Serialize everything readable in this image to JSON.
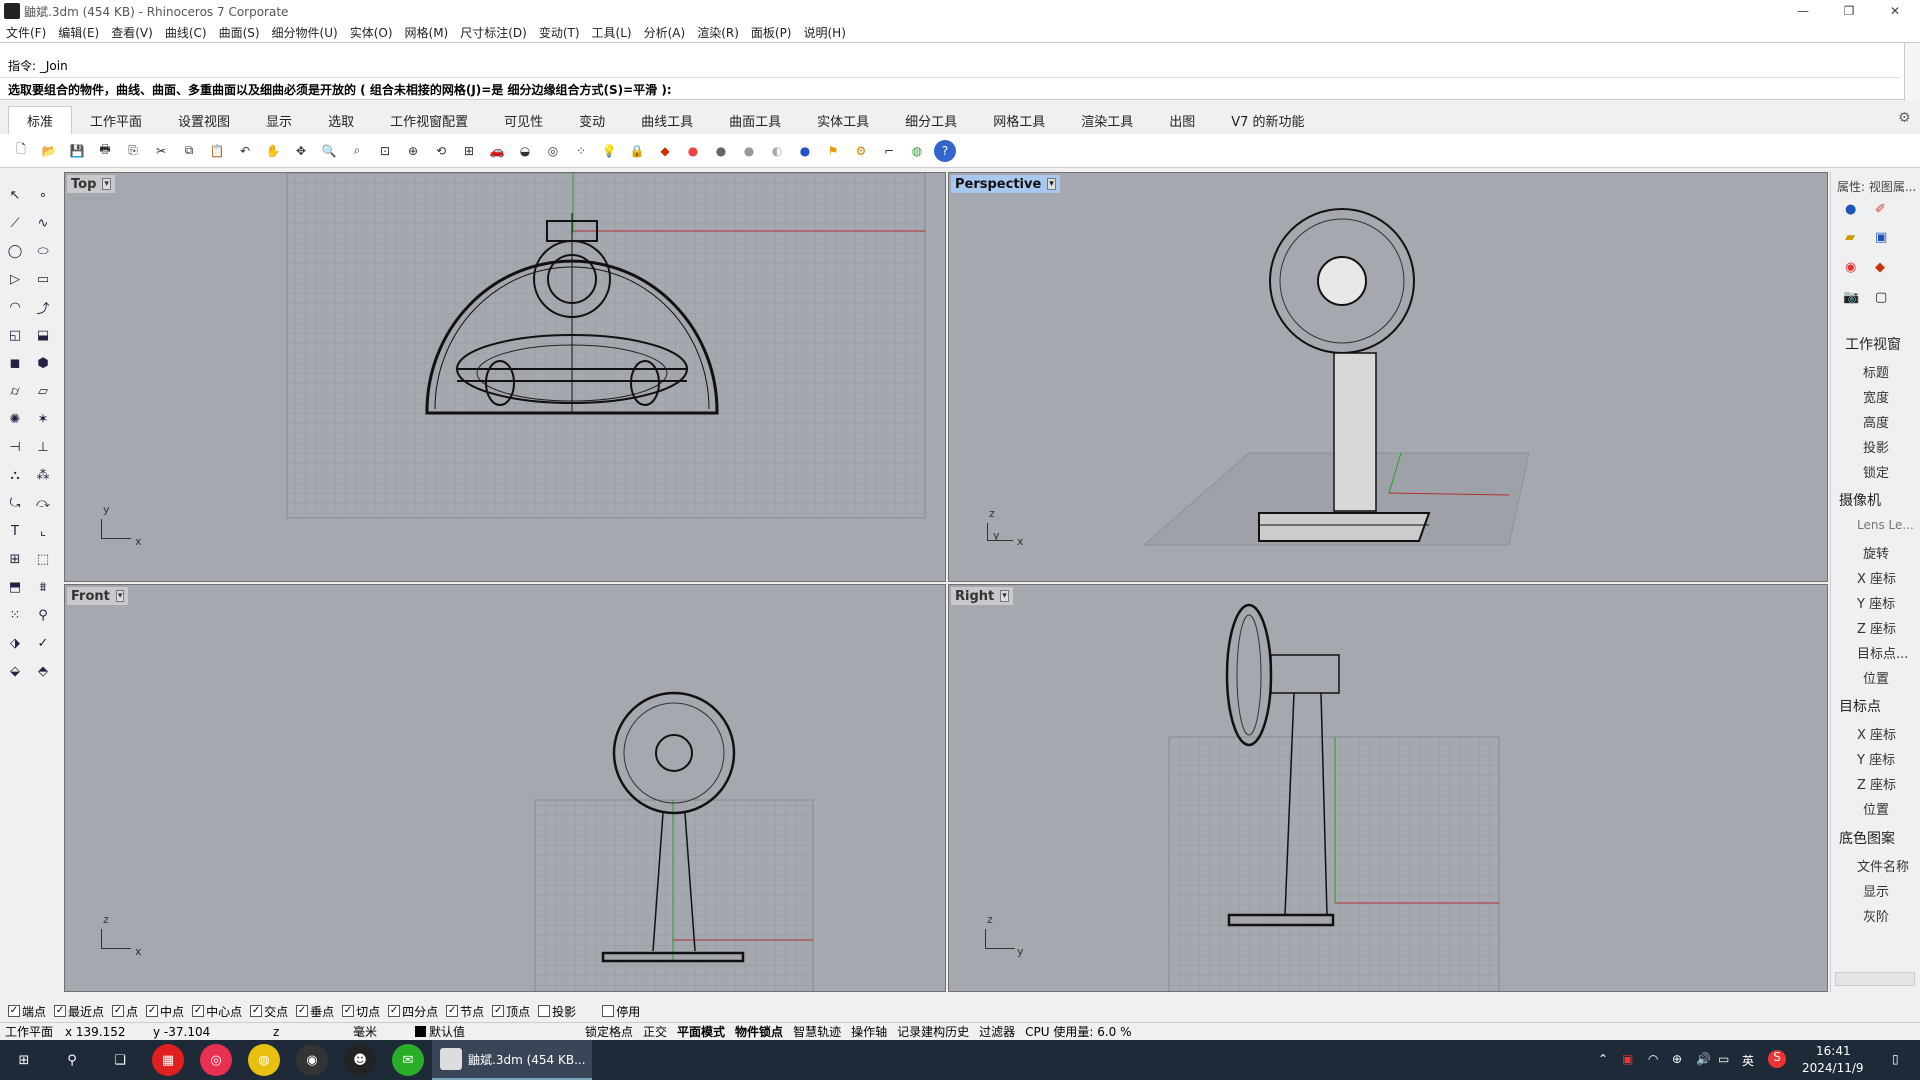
{
  "window": {
    "title": "鼬斌.3dm (454 KB) - Rhinoceros 7 Corporate"
  },
  "menu": [
    "文件(F)",
    "编辑(E)",
    "查看(V)",
    "曲线(C)",
    "曲面(S)",
    "细分物件(U)",
    "实体(O)",
    "网格(M)",
    "尺寸标注(D)",
    "变动(T)",
    "工具(L)",
    "分析(A)",
    "渲染(R)",
    "面板(P)",
    "说明(H)"
  ],
  "command": {
    "history_line": "指令: _Join",
    "prompt": "选取要组合的物件，曲线、曲面、多重曲面以及细曲必须是开放的 ( 组合未相接的网格(J)=是  细分边缘组合方式(S)=平滑 ):"
  },
  "tabs": [
    "标准",
    "工作平面",
    "设置视图",
    "显示",
    "选取",
    "工作视窗配置",
    "可见性",
    "变动",
    "曲线工具",
    "曲面工具",
    "实体工具",
    "细分工具",
    "网格工具",
    "渲染工具",
    "出图",
    "V7 的新功能"
  ],
  "viewports": {
    "top": {
      "label": "Top",
      "axes": [
        "y",
        "x"
      ]
    },
    "perspective": {
      "label": "Perspective",
      "axes": [
        "z",
        "y",
        "x"
      ]
    },
    "front": {
      "label": "Front",
      "axes": [
        "z",
        "x"
      ]
    },
    "right": {
      "label": "Right",
      "axes": [
        "z",
        "y"
      ]
    }
  },
  "right_panel": {
    "header": "属性: 视图属...",
    "section_viewport": "工作视窗",
    "viewport_items": [
      "标题",
      "宽度",
      "高度",
      "投影",
      "锁定"
    ],
    "section_camera": "摄像机",
    "camera_items": [
      "Lens Le...",
      "旋转",
      "X 座标",
      "Y 座标",
      "Z 座标",
      "目标点...",
      "位置"
    ],
    "section_target": "目标点",
    "target_items": [
      "X 座标",
      "Y 座标",
      "Z 座标",
      "位置"
    ],
    "section_wallpaper": "底色图案",
    "wallpaper_items": [
      "文件名称",
      "显示",
      "灰阶"
    ]
  },
  "osnaps": [
    {
      "label": "端点",
      "checked": true
    },
    {
      "label": "最近点",
      "checked": true
    },
    {
      "label": "点",
      "checked": true
    },
    {
      "label": "中点",
      "checked": true
    },
    {
      "label": "中心点",
      "checked": true
    },
    {
      "label": "交点",
      "checked": true
    },
    {
      "label": "垂点",
      "checked": true
    },
    {
      "label": "切点",
      "checked": true
    },
    {
      "label": "四分点",
      "checked": true
    },
    {
      "label": "节点",
      "checked": true
    },
    {
      "label": "顶点",
      "checked": true
    },
    {
      "label": "投影",
      "checked": false
    },
    {
      "label": "停用",
      "checked": false
    }
  ],
  "status": {
    "cplane": "工作平面",
    "x": "x 139.152",
    "y": "y -37.104",
    "z": "z",
    "unit": "毫米",
    "layer": "默认值",
    "toggles": [
      "锁定格点",
      "正交",
      "平面模式",
      "物件锁点",
      "智慧轨迹",
      "操作轴",
      "记录建构历史",
      "过滤器"
    ],
    "cpu": "CPU 使用量: 6.0 %"
  },
  "taskbar": {
    "app_label": "鼬斌.3dm (454 KB...",
    "time": "16:41",
    "date": "2024/11/9",
    "ime": "英"
  },
  "colors": {
    "viewport_bg": "#a5a8ae",
    "active_label": "#a9c8f0",
    "taskbar": "#1f2a38"
  }
}
